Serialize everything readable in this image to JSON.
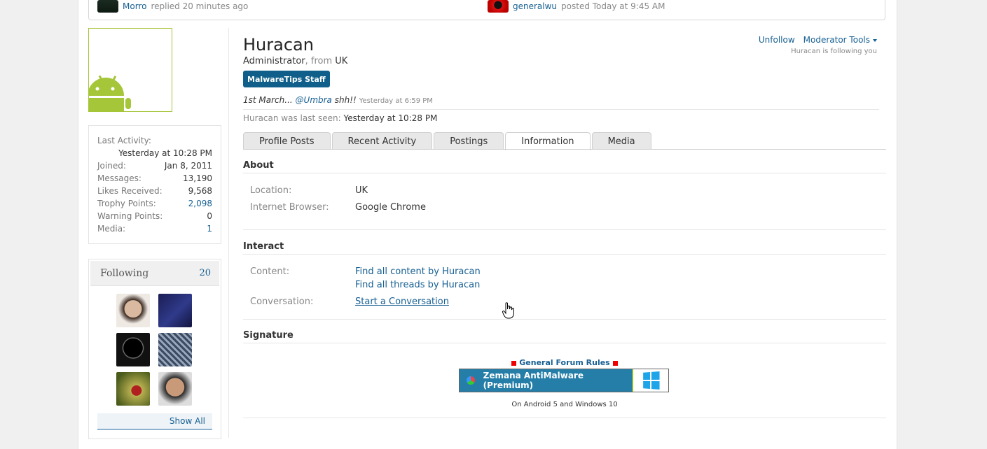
{
  "recent": [
    {
      "user": "Morro",
      "action": "replied 20 minutes ago"
    },
    {
      "user": "generalwu",
      "action": "posted Today at 9:45 AM"
    }
  ],
  "sidebar": {
    "stats": [
      {
        "label": "Last Activity:",
        "value": ""
      },
      {
        "label": "",
        "value": "Yesterday at 10:28 PM"
      },
      {
        "label": "Joined:",
        "value": "Jan 8, 2011"
      },
      {
        "label": "Messages:",
        "value": "13,190"
      },
      {
        "label": "Likes Received:",
        "value": "9,568"
      },
      {
        "label": "Trophy Points:",
        "value": "2,098"
      },
      {
        "label": "Warning Points:",
        "value": "0"
      },
      {
        "label": "Media:",
        "value": "1"
      }
    ],
    "following": {
      "title": "Following",
      "count": "20",
      "show_all": "Show All"
    }
  },
  "profile": {
    "name": "Huracan",
    "role": "Administrator",
    "from_label": ", from",
    "location": "UK",
    "badge": "MalwareTips Staff",
    "status_prefix": "1st March...",
    "status_mention": "@Umbra",
    "status_suffix": "shh!!",
    "status_time": "Yesterday at 6:59 PM",
    "last_seen_label": "Huracan was last seen:",
    "last_seen_value": "Yesterday at 10:28 PM",
    "unfollow": "Unfollow",
    "moderator_tools": "Moderator Tools",
    "follows_you": "Huracan is following you"
  },
  "tabs": [
    "Profile Posts",
    "Recent Activity",
    "Postings",
    "Information",
    "Media"
  ],
  "about": {
    "title": "About",
    "location_label": "Location:",
    "location_value": "UK",
    "browser_label": "Internet Browser:",
    "browser_value": "Google Chrome"
  },
  "interact": {
    "title": "Interact",
    "content_label": "Content:",
    "find_content": "Find all content by Huracan",
    "find_threads": "Find all threads by Huracan",
    "conversation_label": "Conversation:",
    "start_conversation": "Start a Conversation"
  },
  "signature": {
    "title": "Signature",
    "rules": "General Forum Rules",
    "banner": "Zemana AntiMalware (Premium)",
    "os_note": "On Android 5 and Windows 10"
  },
  "colors": {
    "link": "#176093",
    "badge": "#0f5f8a",
    "android": "#a5c639",
    "banner": "#247ea8"
  }
}
